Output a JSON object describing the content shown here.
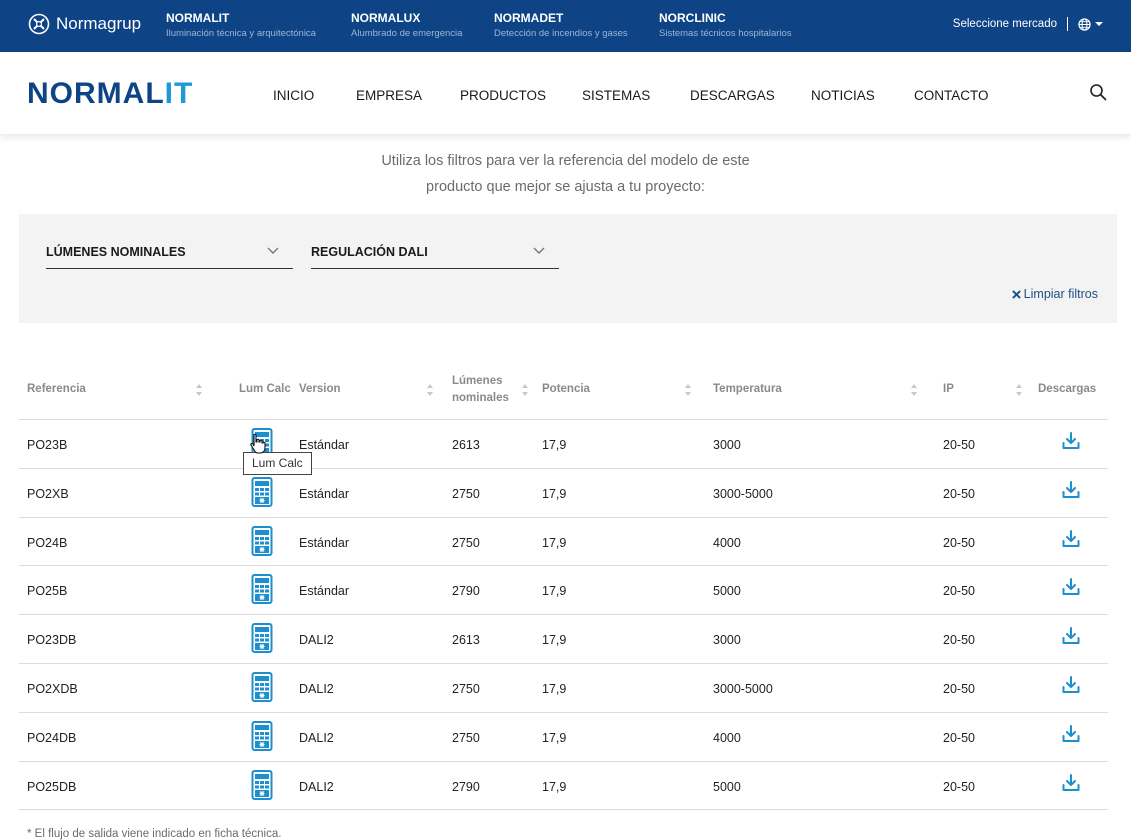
{
  "topbar": {
    "brand": "Normagrup",
    "items": [
      {
        "title": "NORMALIT",
        "sub": "Iluminación técnica y arquitectónica"
      },
      {
        "title": "NORMALUX",
        "sub": "Alumbrado de emergencia"
      },
      {
        "title": "NORMADET",
        "sub": "Detección de incendios y gases"
      },
      {
        "title": "NORCLINIC",
        "sub": "Sistemas técnicos hospitalarios"
      }
    ],
    "market_label": "Seleccione mercado",
    "globe_icon": "globe-icon"
  },
  "header": {
    "logo_main": "NORMAL",
    "logo_accent": "IT",
    "nav": [
      "INICIO",
      "EMPRESA",
      "PRODUCTOS",
      "SISTEMAS",
      "DESCARGAS",
      "NOTICIAS",
      "CONTACTO"
    ],
    "search_icon": "search-icon"
  },
  "intro": {
    "line1": "Utiliza los filtros para ver la referencia del modelo de este",
    "line2": "producto que mejor se ajusta a tu proyecto:"
  },
  "filters": {
    "lumens_label": "LÚMENES NOMINALES",
    "dali_label": "REGULACIÓN DALI",
    "clear_label": "Limpiar filtros"
  },
  "table": {
    "headers": {
      "reference": "Referencia",
      "lumcalc": "Lum Calc",
      "version": "Version",
      "lumens_1": "Lúmenes",
      "lumens_2": "nominales",
      "power": "Potencia",
      "temperature": "Temperatura",
      "ip": "IP",
      "downloads": "Descargas"
    },
    "rows": [
      {
        "ref": "PO23B",
        "version": "Estándar",
        "lumens": "2613",
        "power": "17,9",
        "temp": "3000",
        "ip": "20-50"
      },
      {
        "ref": "PO2XB",
        "version": "Estándar",
        "lumens": "2750",
        "power": "17,9",
        "temp": "3000-5000",
        "ip": "20-50"
      },
      {
        "ref": "PO24B",
        "version": "Estándar",
        "lumens": "2750",
        "power": "17,9",
        "temp": "4000",
        "ip": "20-50"
      },
      {
        "ref": "PO25B",
        "version": "Estándar",
        "lumens": "2790",
        "power": "17,9",
        "temp": "5000",
        "ip": "20-50"
      },
      {
        "ref": "PO23DB",
        "version": "DALI2",
        "lumens": "2613",
        "power": "17,9",
        "temp": "3000",
        "ip": "20-50"
      },
      {
        "ref": "PO2XDB",
        "version": "DALI2",
        "lumens": "2750",
        "power": "17,9",
        "temp": "3000-5000",
        "ip": "20-50"
      },
      {
        "ref": "PO24DB",
        "version": "DALI2",
        "lumens": "2750",
        "power": "17,9",
        "temp": "4000",
        "ip": "20-50"
      },
      {
        "ref": "PO25DB",
        "version": "DALI2",
        "lumens": "2790",
        "power": "17,9",
        "temp": "5000",
        "ip": "20-50"
      }
    ]
  },
  "tooltip": "Lum Calc",
  "footnote": "* El flujo de salida viene indicado en ficha técnica.",
  "colors": {
    "topbar": "#0e4486",
    "brand_blue": "#0e4486",
    "accent": "#1d9ad6",
    "filter_bg": "#f3f3f3"
  }
}
